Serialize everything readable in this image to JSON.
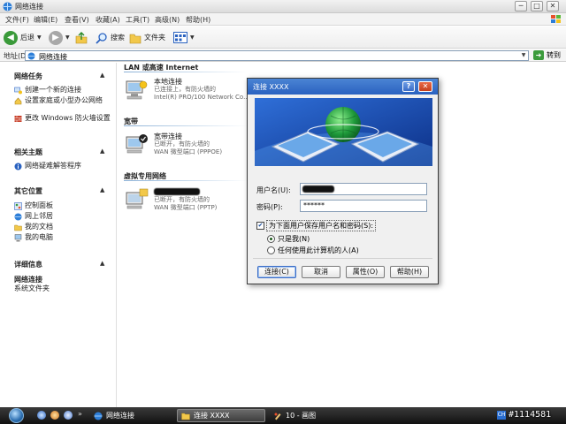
{
  "window": {
    "title": "网络连接",
    "min": "─",
    "max": "□",
    "close": "✕"
  },
  "menu": [
    "文件(F)",
    "编辑(E)",
    "查看(V)",
    "收藏(A)",
    "工具(T)",
    "高级(N)",
    "帮助(H)"
  ],
  "toolbar": {
    "back": "后退",
    "search": "搜索",
    "folders": "文件夹"
  },
  "address": {
    "label": "地址(D)",
    "value": "网络连接",
    "go": "转到"
  },
  "left": {
    "network_tasks": {
      "title": "网络任务",
      "items": [
        "创建一个新的连接",
        "设置家庭或小型办公网络",
        "更改 Windows 防火墙设置"
      ]
    },
    "see_also": {
      "title": "相关主题",
      "items": [
        "网络疑难解答程序"
      ]
    },
    "other_places": {
      "title": "其它位置",
      "items": [
        "控制面板",
        "网上邻居",
        "我的文档",
        "我的电脑"
      ]
    },
    "details": {
      "title": "详细信息",
      "name": "网络连接",
      "type": "系统文件夹"
    }
  },
  "content": {
    "lan": {
      "header": "LAN 或高速 Internet",
      "name": "本地连接",
      "status": "已连接上，有防火墙的",
      "device": "Intel(R) PRO/100 Network Co..."
    },
    "broadband": {
      "header": "宽带",
      "name": "宽带连接",
      "status": "已断开，有防火墙的",
      "device": "WAN 微型端口 (PPPOE)"
    },
    "vpn": {
      "header": "虚拟专用网络",
      "status": "已断开，有防火墙的",
      "device": "WAN 微型端口 (PPTP)"
    }
  },
  "dialog": {
    "title": "连接 XXXX",
    "help": "?",
    "close": "✕",
    "username_label": "用户名(U):",
    "password_label": "密码(P):",
    "password_value": "******",
    "save_checkbox": "为下面用户保存用户名和密码(S):",
    "radio_me": "只是我(N)",
    "radio_anyone": "任何使用此计算机的人(A)",
    "buttons": {
      "connect": "连接(C)",
      "cancel": "取消",
      "properties": "属性(O)",
      "help": "帮助(H)"
    }
  },
  "taskbar": {
    "tasks": [
      "网络连接",
      "连接 XXXX",
      "10 - 画图"
    ],
    "tray_badge": "CH",
    "watermark": "#1114581"
  }
}
